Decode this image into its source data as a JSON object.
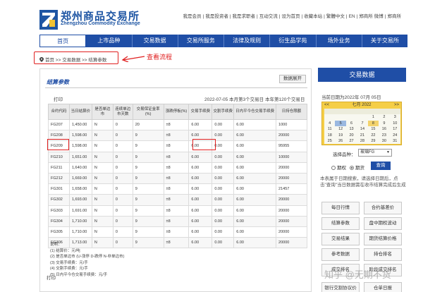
{
  "brand": {
    "name_cn": "郑州商品交易所",
    "name_en": "Zhengzhou Commodity Exchange",
    "primary_color": "#1f4ea6"
  },
  "top_links": [
    "我是会员",
    "|",
    "我是投资者",
    "|",
    "我是求职者",
    "|",
    "互动交流",
    "|",
    "设为首页",
    "|",
    "收藏本站",
    "|",
    "繁體中文",
    "|",
    "EN",
    "|",
    "郑商所",
    "微博",
    "|",
    "郑商所"
  ],
  "nav": [
    {
      "label": "首页",
      "active": true
    },
    {
      "label": "上市品种",
      "active": false
    },
    {
      "label": "交易数据",
      "active": false
    },
    {
      "label": "交易所服务",
      "active": false
    },
    {
      "label": "法律及规则",
      "active": false
    },
    {
      "label": "衍生品学苑",
      "active": false
    },
    {
      "label": "场外业务",
      "active": false
    },
    {
      "label": "关于交易所",
      "active": false
    }
  ],
  "breadcrumb": "首页 >> 交易数据 >> 结算参数",
  "annotation": "查看流程",
  "panel": {
    "title": "结算参数",
    "download_label": "数据展开",
    "print_label": "打印",
    "date_line": "2022-07-05  本月第3个交易日  本年第120个交易日"
  },
  "table": {
    "headers": [
      "合约代码",
      "当日结算价",
      "是否单边市",
      "连续单边市天数",
      "交易保证金率(%)",
      "涨跌停板(%)",
      "交易手续费",
      "交割手续费",
      "日内平今仓交易手续费",
      "日持仓限额"
    ],
    "rows": [
      [
        "FG207",
        "1,450.00",
        "N",
        "0",
        "20",
        "±8",
        "6.00",
        "0.00",
        "6.00",
        "1000"
      ],
      [
        "FG208",
        "1,598.00",
        "N",
        "0",
        "9",
        "±8",
        "6.00",
        "0.00",
        "6.00",
        "20000"
      ],
      [
        "FG209",
        "1,598.00",
        "N",
        "0",
        "9",
        "±8",
        "6.00",
        "0.00",
        "6.00",
        "95955"
      ],
      [
        "FG210",
        "1,651.00",
        "N",
        "0",
        "9",
        "±8",
        "6.00",
        "0.00",
        "6.00",
        "10000"
      ],
      [
        "FG211",
        "1,640.00",
        "N",
        "0",
        "9",
        "±8",
        "6.00",
        "0.00",
        "6.00",
        "20000"
      ],
      [
        "FG212",
        "1,669.00",
        "N",
        "0",
        "9",
        "±8",
        "6.00",
        "0.00",
        "6.00",
        "20000"
      ],
      [
        "FG301",
        "1,658.00",
        "N",
        "0",
        "9",
        "±8",
        "6.00",
        "0.00",
        "6.00",
        "21457"
      ],
      [
        "FG302",
        "1,693.00",
        "N",
        "0",
        "9",
        "±8",
        "6.00",
        "0.00",
        "6.00",
        "20000"
      ],
      [
        "FG303",
        "1,691.00",
        "N",
        "0",
        "9",
        "±8",
        "6.00",
        "0.00",
        "6.00",
        "20000"
      ],
      [
        "FG304",
        "1,710.00",
        "N",
        "0",
        "9",
        "±8",
        "6.00",
        "0.00",
        "6.00",
        "20000"
      ],
      [
        "FG305",
        "1,710.00",
        "N",
        "0",
        "9",
        "±8",
        "6.00",
        "0.00",
        "6.00",
        "20000"
      ],
      [
        "FG306",
        "1,713.00",
        "N",
        "0",
        "9",
        "±8",
        "6.00",
        "0.00",
        "6.00",
        "20000"
      ]
    ]
  },
  "notes": [
    "说明：",
    "(1) 结算价：元/吨",
    "(2) 是否单边市 (U-涨停 D-跌停 N-非单边市)",
    "(3) 交易手续费：元/手",
    "(4) 交割手续费：元/手",
    "(5) 日内平今仓交易手续费：元/手"
  ],
  "print_bottom": "打印",
  "sidebar": {
    "title": "交易数据",
    "current_date": "当前日期为2022年 07月 05日",
    "calendar": {
      "prev": "<<",
      "month": "七月 2022",
      "next": ">>",
      "weekdays": [
        "",
        "",
        "",
        "",
        "",
        "",
        ""
      ],
      "days": [
        "",
        "",
        "",
        "",
        "1",
        "2",
        "3",
        "4",
        "5",
        "6",
        "7",
        "8",
        "9",
        "10",
        "11",
        "12",
        "13",
        "14",
        "15",
        "16",
        "17",
        "18",
        "19",
        "20",
        "21",
        "22",
        "23",
        "24",
        "25",
        "26",
        "27",
        "28",
        "29",
        "30",
        "31"
      ]
    },
    "select_label": "选择品种：",
    "select_value": "玻璃FG",
    "radio_1": "期权",
    "radio_2": "期货",
    "query_label": "查询",
    "hint": "本表属于日期搜索，请选择日期后，点击\"查询\"当日数据需在收市结算完成后生成",
    "buttons": [
      "每日行情",
      "合约基差价",
      "结算参数",
      "盘中期权波动",
      "交易结果",
      "期货结算价格",
      "参考数据",
      "持仓排名",
      "成交排名",
      "阶段成交排名",
      "",
      "",
      "银行交割协议价",
      "仓单日报"
    ]
  },
  "watermark": "知乎 @无期不货"
}
